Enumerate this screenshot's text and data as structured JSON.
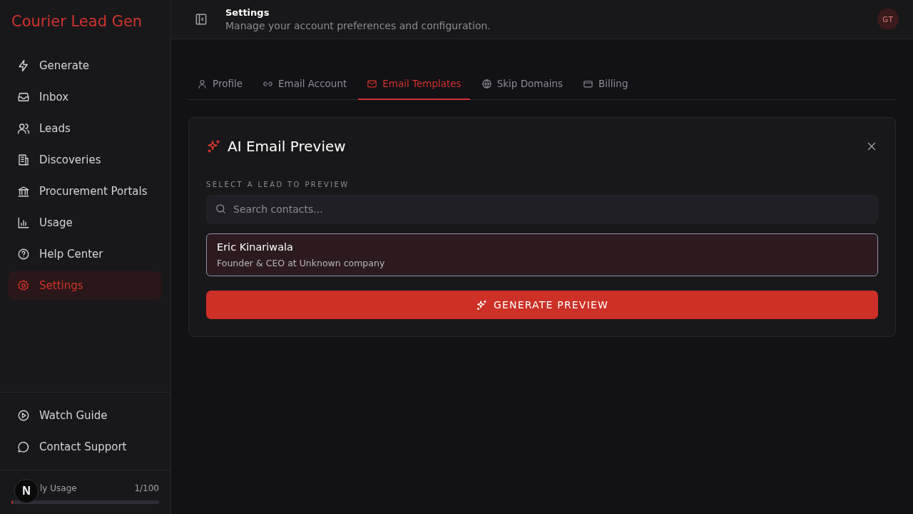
{
  "sidebar": {
    "brand": "Courier Lead Gen",
    "items": [
      {
        "label": "Generate",
        "selected": false
      },
      {
        "label": "Inbox",
        "selected": false
      },
      {
        "label": "Leads",
        "selected": false
      },
      {
        "label": "Discoveries",
        "selected": false
      },
      {
        "label": "Procurement Portals",
        "selected": false
      },
      {
        "label": "Usage",
        "selected": false
      },
      {
        "label": "Help Center",
        "selected": false
      },
      {
        "label": "Settings",
        "selected": true
      }
    ],
    "footer_items": [
      {
        "label": "Watch Guide"
      },
      {
        "label": "Contact Support"
      }
    ],
    "usage": {
      "badge": "N",
      "label": "ly Usage",
      "reading": "1/100",
      "level": 0.01
    }
  },
  "header": {
    "title": "Settings",
    "subtitle": "Manage your account preferences and configuration.",
    "avatar": "GT"
  },
  "tabs": [
    {
      "label": "Profile",
      "selected": false
    },
    {
      "label": "Email Account",
      "selected": false
    },
    {
      "label": "Email Templates",
      "selected": true
    },
    {
      "label": "Skip Domains",
      "selected": false
    },
    {
      "label": "Billing",
      "selected": false
    }
  ],
  "panel": {
    "title": "AI Email Preview",
    "section_label": "SELECT A LEAD TO PREVIEW",
    "search": {
      "placeholder": "Search contacts..."
    },
    "leads": [
      {
        "name": "Eric Kinariwala",
        "subtitle": "Founder & CEO at Unknown company",
        "selected": true
      }
    ],
    "button": "GENERATE PREVIEW"
  }
}
